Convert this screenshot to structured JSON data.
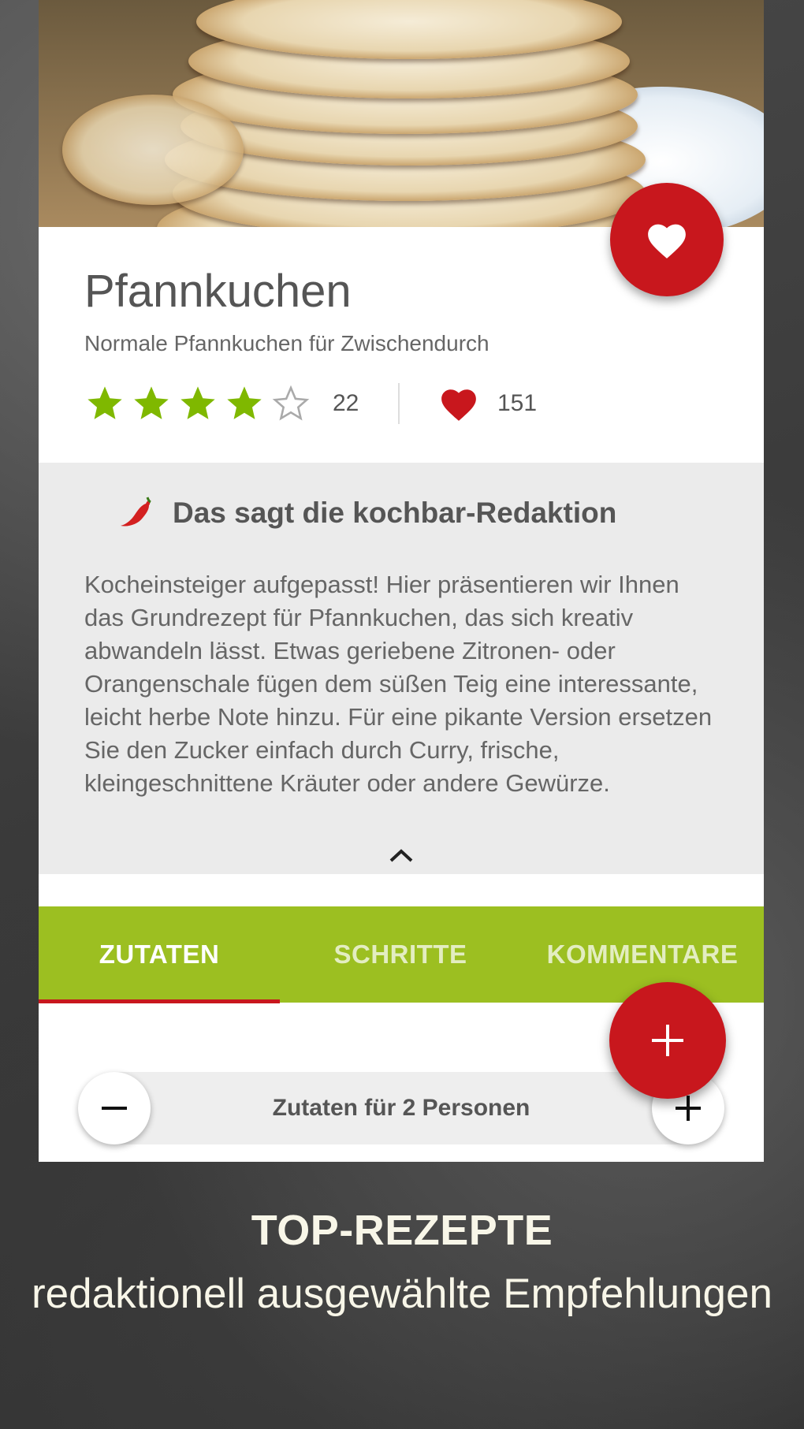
{
  "recipe": {
    "title": "Pfannkuchen",
    "subtitle": "Normale Pfannkuchen für Zwischendurch",
    "rating": 4,
    "rating_max": 5,
    "rating_count": "22",
    "likes": "151"
  },
  "editorial": {
    "heading": "Das sagt die kochbar-Redaktion",
    "text": "Kocheinsteiger aufgepasst!  Hier präsentieren wir Ihnen das Grundrezept für Pfannkuchen, das sich kreativ abwandeln lässt.  Etwas geriebene Zitronen- oder Orangenschale fügen dem süßen Teig eine interessante, leicht herbe Note hinzu. Für eine pikante Version ersetzen Sie den Zucker einfach durch Curry, frische, kleingeschnittene Kräuter oder andere Gewürze."
  },
  "tabs": [
    {
      "label": "ZUTATEN",
      "active": true
    },
    {
      "label": "SCHRITTE",
      "active": false
    },
    {
      "label": "KOMMENTARE",
      "active": false
    }
  ],
  "portions": {
    "label": "Zutaten für 2 Personen"
  },
  "promo": {
    "title": "TOP-REZEPTE",
    "subtitle": "redaktionell ausgewählte Empfehlungen"
  },
  "icons": {
    "favorite": "heart-icon",
    "star": "star-icon",
    "chili": "chili-icon",
    "collapse": "chevron-up-icon",
    "decrease": "minus-icon",
    "increase": "plus-icon",
    "add": "plus-icon"
  },
  "colors": {
    "accent_red": "#c8171d",
    "tab_green": "#9cbf21",
    "star_green": "#7fb800"
  }
}
